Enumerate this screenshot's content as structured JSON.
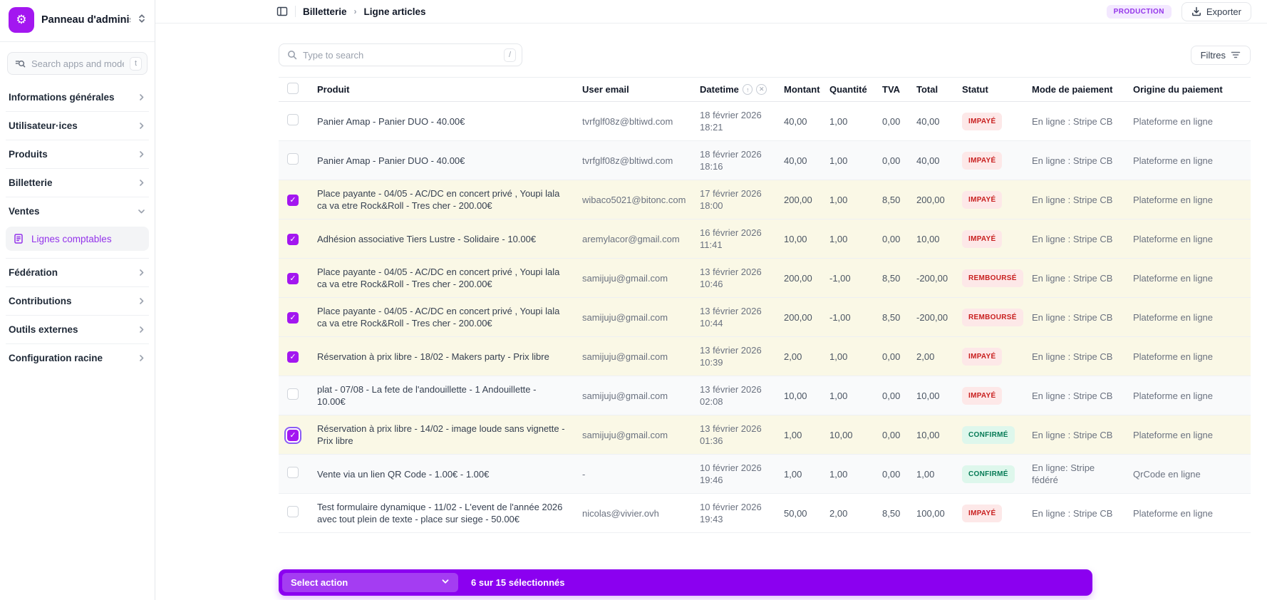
{
  "colors": {
    "accent_purple": "#9333ea",
    "bright_purple": "#a317f0",
    "action_bar_purple": "#8b00f0",
    "selected_row_bg": "#faf8e6",
    "badge_danger_bg": "#fde8e8",
    "badge_danger_text": "#c81e1e",
    "badge_success_bg": "#def7ec",
    "badge_success_text": "#057a55",
    "env_badge_bg": "#f3e8ff"
  },
  "sidebar": {
    "title": "Panneau d'adminis...",
    "search_placeholder": "Search apps and model...",
    "search_shortcut": "t",
    "items": [
      {
        "label": "Informations générales"
      },
      {
        "label": "Utilisateur·ices"
      },
      {
        "label": "Produits"
      },
      {
        "label": "Billetterie"
      },
      {
        "label": "Ventes"
      },
      {
        "label": "Fédération"
      },
      {
        "label": "Contributions"
      },
      {
        "label": "Outils externes"
      },
      {
        "label": "Configuration racine"
      }
    ],
    "active_sub_item": "Lignes comptables"
  },
  "breadcrumb": {
    "section": "Billetterie",
    "page": "Ligne articles"
  },
  "header": {
    "environment": "PRODUCTION",
    "export_label": "Exporter"
  },
  "toolbar": {
    "search_placeholder": "Type to search",
    "search_shortcut": "/",
    "filters_label": "Filtres"
  },
  "table": {
    "columns": {
      "produit": "Produit",
      "user_email": "User email",
      "datetime": "Datetime",
      "montant": "Montant",
      "quantite": "Quantité",
      "tva": "TVA",
      "total": "Total",
      "statut": "Statut",
      "mode_paiement": "Mode de paiement",
      "origine_paiement": "Origine du paiement"
    },
    "rows": [
      {
        "product": "Panier Amap - Panier DUO - 40.00€",
        "user_email": "tvrfglf08z@bltiwd.com",
        "date": "18 février 2026",
        "time": "18:21",
        "montant": "40,00",
        "quantite": "1,00",
        "tva": "0,00",
        "total": "40,00",
        "statut": "IMPAYÉ",
        "statut_type": "danger",
        "mode_paiement": "En ligne : Stripe CB",
        "origine_paiement": "Plateforme en ligne",
        "selected": false,
        "focused": false
      },
      {
        "product": "Panier Amap - Panier DUO - 40.00€",
        "user_email": "tvrfglf08z@bltiwd.com",
        "date": "18 février 2026",
        "time": "18:16",
        "montant": "40,00",
        "quantite": "1,00",
        "tva": "0,00",
        "total": "40,00",
        "statut": "IMPAYÉ",
        "statut_type": "danger",
        "mode_paiement": "En ligne : Stripe CB",
        "origine_paiement": "Plateforme en ligne",
        "selected": false,
        "focused": false
      },
      {
        "product": "Place payante - 04/05 - AC/DC en concert privé , Youpi lala ca va etre Rock&Roll - Tres cher - 200.00€",
        "user_email": "wibaco5021@bitonc.com",
        "date": "17 février 2026",
        "time": "18:00",
        "montant": "200,00",
        "quantite": "1,00",
        "tva": "8,50",
        "total": "200,00",
        "statut": "IMPAYÉ",
        "statut_type": "danger",
        "mode_paiement": "En ligne : Stripe CB",
        "origine_paiement": "Plateforme en ligne",
        "selected": true,
        "focused": false
      },
      {
        "product": "Adhésion associative Tiers Lustre - Solidaire - 10.00€",
        "user_email": "aremylacor@gmail.com",
        "date": "16 février 2026",
        "time": "11:41",
        "montant": "10,00",
        "quantite": "1,00",
        "tva": "0,00",
        "total": "10,00",
        "statut": "IMPAYÉ",
        "statut_type": "danger",
        "mode_paiement": "En ligne : Stripe CB",
        "origine_paiement": "Plateforme en ligne",
        "selected": true,
        "focused": false
      },
      {
        "product": "Place payante - 04/05 - AC/DC en concert privé , Youpi lala ca va etre Rock&Roll - Tres cher - 200.00€",
        "user_email": "samijuju@gmail.com",
        "date": "13 février 2026",
        "time": "10:46",
        "montant": "200,00",
        "quantite": "-1,00",
        "tva": "8,50",
        "total": "-200,00",
        "statut": "REMBOURSÉ",
        "statut_type": "danger",
        "mode_paiement": "En ligne : Stripe CB",
        "origine_paiement": "Plateforme en ligne",
        "selected": true,
        "focused": false
      },
      {
        "product": "Place payante - 04/05 - AC/DC en concert privé , Youpi lala ca va etre Rock&Roll - Tres cher - 200.00€",
        "user_email": "samijuju@gmail.com",
        "date": "13 février 2026",
        "time": "10:44",
        "montant": "200,00",
        "quantite": "-1,00",
        "tva": "8,50",
        "total": "-200,00",
        "statut": "REMBOURSÉ",
        "statut_type": "danger",
        "mode_paiement": "En ligne : Stripe CB",
        "origine_paiement": "Plateforme en ligne",
        "selected": true,
        "focused": false
      },
      {
        "product": "Réservation à prix libre - 18/02 - Makers party - Prix libre",
        "user_email": "samijuju@gmail.com",
        "date": "13 février 2026",
        "time": "10:39",
        "montant": "2,00",
        "quantite": "1,00",
        "tva": "0,00",
        "total": "2,00",
        "statut": "IMPAYÉ",
        "statut_type": "danger",
        "mode_paiement": "En ligne : Stripe CB",
        "origine_paiement": "Plateforme en ligne",
        "selected": true,
        "focused": false
      },
      {
        "product": "plat - 07/08 - La fete de l'andouillette - 1 Andouillette - 10.00€",
        "user_email": "samijuju@gmail.com",
        "date": "13 février 2026",
        "time": "02:08",
        "montant": "10,00",
        "quantite": "1,00",
        "tva": "0,00",
        "total": "10,00",
        "statut": "IMPAYÉ",
        "statut_type": "danger",
        "mode_paiement": "En ligne : Stripe CB",
        "origine_paiement": "Plateforme en ligne",
        "selected": false,
        "focused": false
      },
      {
        "product": "Réservation à prix libre - 14/02 - image loude sans vignette - Prix libre",
        "user_email": "samijuju@gmail.com",
        "date": "13 février 2026",
        "time": "01:36",
        "montant": "1,00",
        "quantite": "10,00",
        "tva": "0,00",
        "total": "10,00",
        "statut": "CONFIRMÉ",
        "statut_type": "success",
        "mode_paiement": "En ligne : Stripe CB",
        "origine_paiement": "Plateforme en ligne",
        "selected": true,
        "focused": true
      },
      {
        "product": "Vente via un lien QR Code - 1.00€ - 1.00€",
        "user_email": "-",
        "date": "10 février 2026",
        "time": "19:46",
        "montant": "1,00",
        "quantite": "1,00",
        "tva": "0,00",
        "total": "1,00",
        "statut": "CONFIRMÉ",
        "statut_type": "success",
        "mode_paiement": "En ligne: Stripe fédéré",
        "origine_paiement": "QrCode en ligne",
        "selected": false,
        "focused": false
      },
      {
        "product": "Test formulaire dynamique - 11/02 - L'event de l'année 2026 avec tout plein de texte - place sur siege - 50.00€",
        "user_email": "nicolas@vivier.ovh",
        "date": "10 février 2026",
        "time": "19:43",
        "montant": "50,00",
        "quantite": "2,00",
        "tva": "8,50",
        "total": "100,00",
        "statut": "IMPAYÉ",
        "statut_type": "danger",
        "mode_paiement": "En ligne : Stripe CB",
        "origine_paiement": "Plateforme en ligne",
        "selected": false,
        "focused": false
      }
    ]
  },
  "action_bar": {
    "select_label": "Select action",
    "selection_text": "6 sur 15 sélectionnés"
  }
}
